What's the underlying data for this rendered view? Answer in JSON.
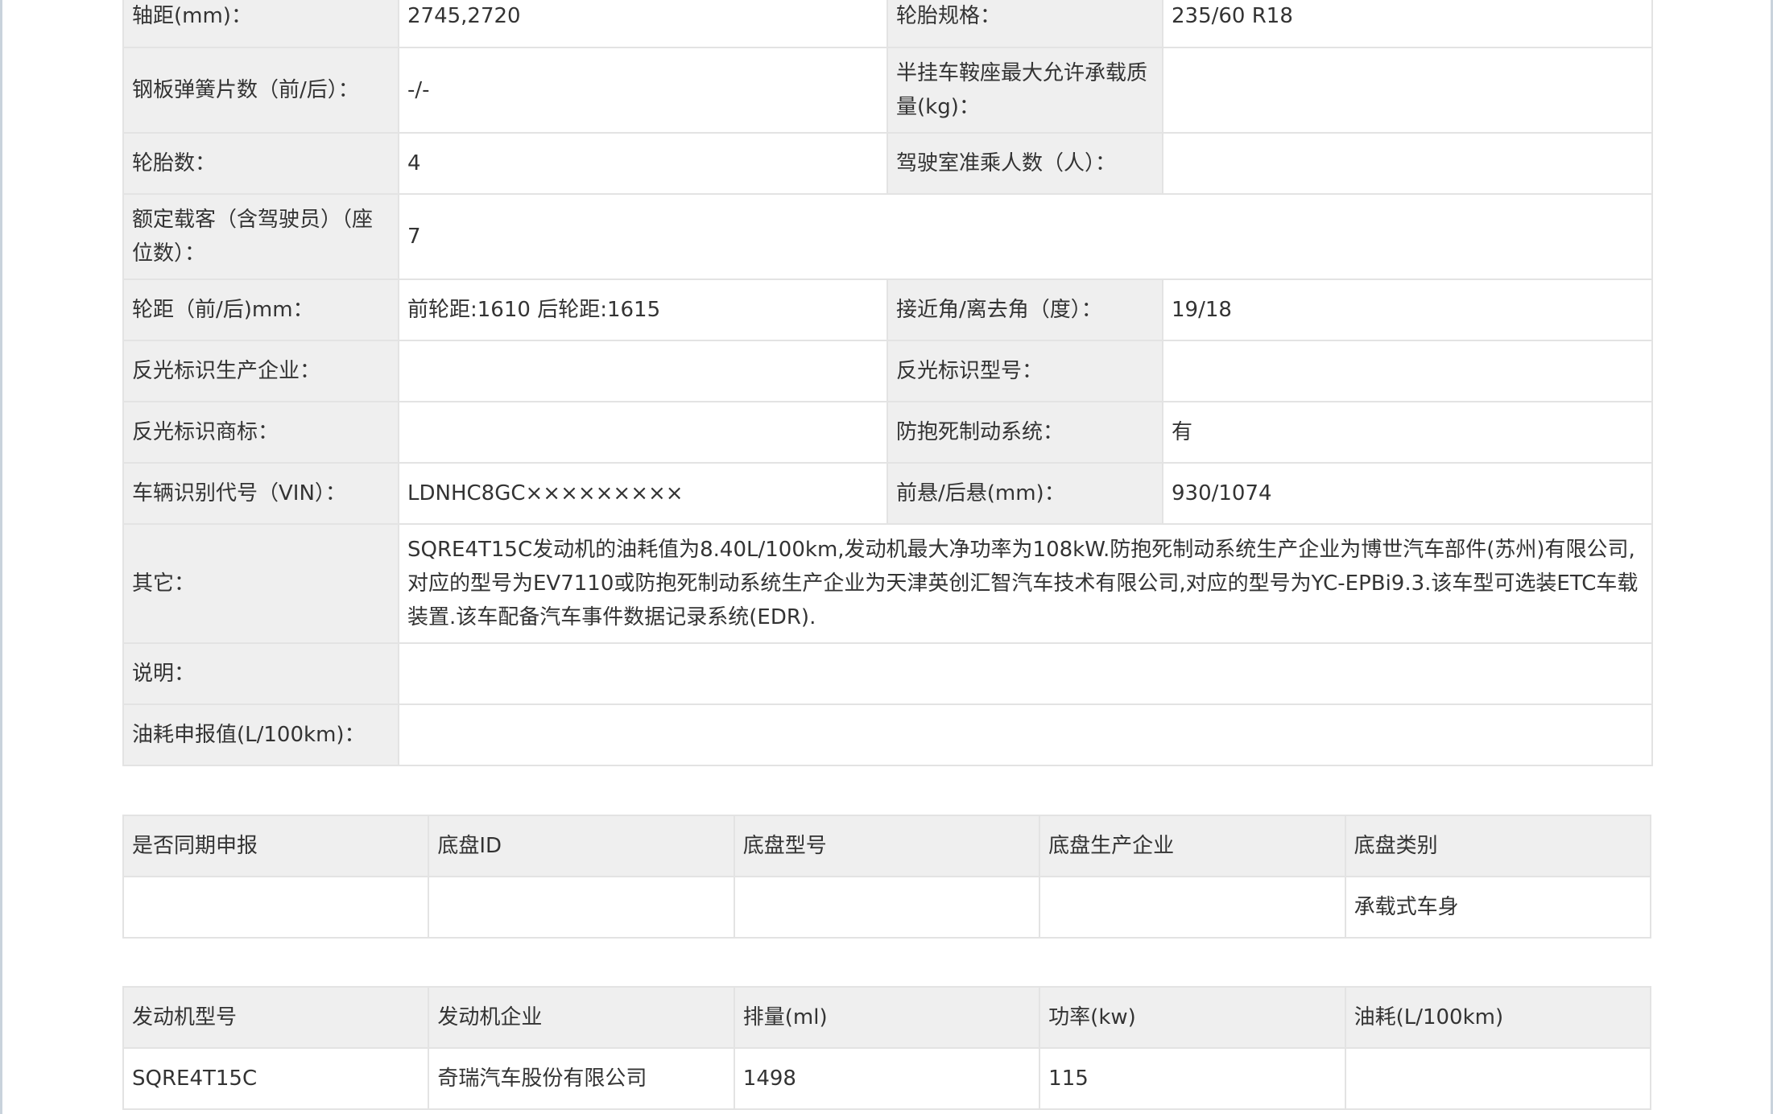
{
  "specs": {
    "wheelbase_label": "轴距(mm)：",
    "wheelbase_value": "2745,2720",
    "tire_spec_label": "轮胎规格：",
    "tire_spec_value": "235/60 R18",
    "leaf_spring_label": "钢板弹簧片数（前/后）：",
    "leaf_spring_value": "-/-",
    "saddle_load_label": "半挂车鞍座最大允许承载质量(kg)：",
    "saddle_load_value": "",
    "tire_count_label": "轮胎数：",
    "tire_count_value": "4",
    "cab_passengers_label": "驾驶室准乘人数（人）：",
    "cab_passengers_value": "",
    "rated_passengers_label": "额定载客（含驾驶员）（座位数）：",
    "rated_passengers_value": "7",
    "track_label": "轮距（前/后)mm：",
    "track_value": "前轮距:1610 后轮距:1615",
    "approach_angle_label": "接近角/离去角（度）：",
    "approach_angle_value": "19/18",
    "reflector_maker_label": "反光标识生产企业：",
    "reflector_maker_value": "",
    "reflector_model_label": "反光标识型号：",
    "reflector_model_value": "",
    "reflector_brand_label": "反光标识商标：",
    "reflector_brand_value": "",
    "abs_label": "防抱死制动系统：",
    "abs_value": "有",
    "vin_label": "车辆识别代号（VIN）：",
    "vin_value": "LDNHC8GC×××××××××",
    "overhang_label": "前悬/后悬(mm)：",
    "overhang_value": "930/1074",
    "other_label": "其它：",
    "other_value": "SQRE4T15C发动机的油耗值为8.40L/100km,发动机最大净功率为108kW.防抱死制动系统生产企业为博世汽车部件(苏州)有限公司,对应的型号为EV7110或防抱死制动系统生产企业为天津英创汇智汽车技术有限公司,对应的型号为YC-EPBi9.3.该车型可选装ETC车载装置.该车配备汽车事件数据记录系统(EDR).",
    "note_label": "说明：",
    "note_value": "",
    "fuel_declared_label": "油耗申报值(L/100km)：",
    "fuel_declared_value": ""
  },
  "chassis": {
    "headers": [
      "是否同期申报",
      "底盘ID",
      "底盘型号",
      "底盘生产企业",
      "底盘类别"
    ],
    "row": [
      "",
      "",
      "",
      "",
      "承载式车身"
    ]
  },
  "engine": {
    "headers": [
      "发动机型号",
      "发动机企业",
      "排量(ml)",
      "功率(kw)",
      "油耗(L/100km)"
    ],
    "row": [
      "SQRE4T15C",
      "奇瑞汽车股份有限公司",
      "1498",
      "115",
      ""
    ]
  }
}
